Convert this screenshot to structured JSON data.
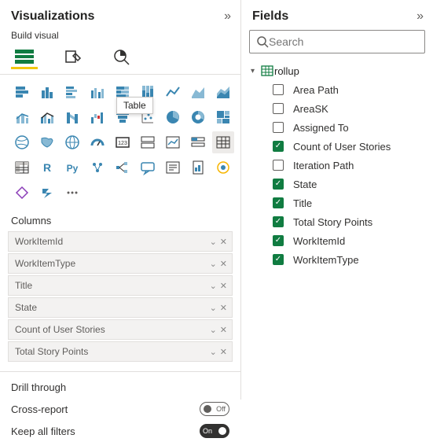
{
  "panes": {
    "viz_title": "Visualizations",
    "fields_title": "Fields"
  },
  "build": {
    "subhead": "Build visual"
  },
  "tooltip": {
    "table": "Table"
  },
  "columns": {
    "title": "Columns",
    "items": [
      {
        "label": "WorkItemId"
      },
      {
        "label": "WorkItemType"
      },
      {
        "label": "Title"
      },
      {
        "label": "State"
      },
      {
        "label": "Count of User Stories"
      },
      {
        "label": "Total Story Points"
      }
    ]
  },
  "drill": {
    "title": "Drill through",
    "cross": "Cross-report",
    "cross_state": "Off",
    "keep": "Keep all filters",
    "keep_state": "On"
  },
  "search": {
    "placeholder": "Search"
  },
  "tree": {
    "table_name": "rollup",
    "fields": [
      {
        "label": "Area Path",
        "checked": false
      },
      {
        "label": "AreaSK",
        "checked": false
      },
      {
        "label": "Assigned To",
        "checked": false
      },
      {
        "label": "Count of User Stories",
        "checked": true
      },
      {
        "label": "Iteration Path",
        "checked": false
      },
      {
        "label": "State",
        "checked": true
      },
      {
        "label": "Title",
        "checked": true
      },
      {
        "label": "Total Story Points",
        "checked": true
      },
      {
        "label": "WorkItemId",
        "checked": true
      },
      {
        "label": "WorkItemType",
        "checked": true
      }
    ]
  }
}
